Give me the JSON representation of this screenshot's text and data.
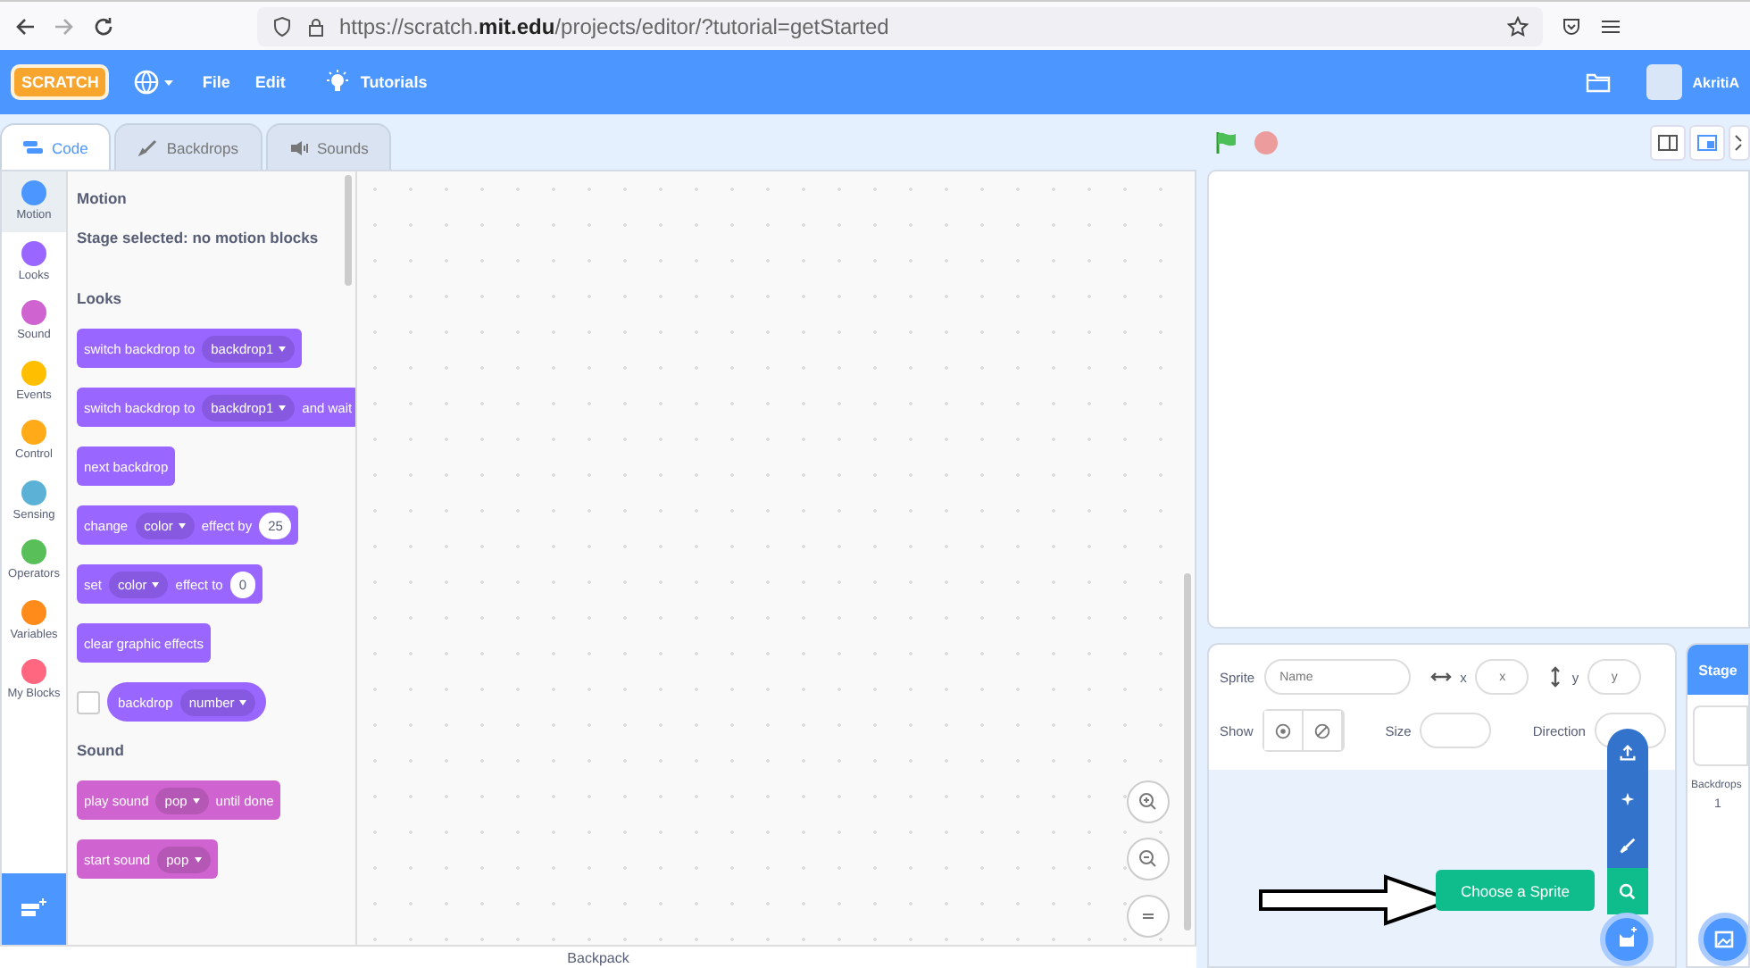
{
  "browser": {
    "url": "https://scratch.**mit.edu**/projects/editor/?tutorial=getStarted"
  },
  "menubar": {
    "logo": "SCRATCH",
    "items": [
      "File",
      "Edit"
    ],
    "tutorials": "Tutorials",
    "user": "AkritiA"
  },
  "tabs": [
    {
      "label": "Code",
      "selected": true
    },
    {
      "label": "Backdrops",
      "selected": false
    },
    {
      "label": "Sounds",
      "selected": false
    }
  ],
  "categories": [
    {
      "label": "Motion",
      "color": "#4c97ff",
      "selected": true
    },
    {
      "label": "Looks",
      "color": "#9966ff",
      "selected": false
    },
    {
      "label": "Sound",
      "color": "#cf63cf",
      "selected": false
    },
    {
      "label": "Events",
      "color": "#ffbf00",
      "selected": false
    },
    {
      "label": "Control",
      "color": "#ffab19",
      "selected": false
    },
    {
      "label": "Sensing",
      "color": "#5cb1d6",
      "selected": false
    },
    {
      "label": "Operators",
      "color": "#59c059",
      "selected": false
    },
    {
      "label": "Variables",
      "color": "#ff8c1a",
      "selected": false
    },
    {
      "label": "My Blocks",
      "color": "#ff6680",
      "selected": false
    }
  ],
  "palette": [
    {
      "title": "Motion",
      "note": "Stage selected: no motion blocks"
    },
    {
      "title": "Looks",
      "color": "#9966ff",
      "blocks": [
        {
          "kind": "stack",
          "parts": [
            {
              "kind": "text",
              "text": "switch backdrop to"
            },
            {
              "kind": "dropdown",
              "text": "backdrop1"
            }
          ]
        },
        {
          "kind": "stack",
          "parts": [
            {
              "kind": "text",
              "text": "switch backdrop to"
            },
            {
              "kind": "dropdown",
              "text": "backdrop1"
            },
            {
              "kind": "text",
              "text": "and wait"
            }
          ]
        },
        {
          "kind": "stack",
          "parts": [
            {
              "kind": "text",
              "text": "next backdrop"
            }
          ]
        },
        {
          "kind": "stack",
          "parts": [
            {
              "kind": "text",
              "text": "change"
            },
            {
              "kind": "dropdown",
              "text": "color"
            },
            {
              "kind": "text",
              "text": "effect by"
            },
            {
              "kind": "number",
              "text": "25"
            }
          ]
        },
        {
          "kind": "stack",
          "parts": [
            {
              "kind": "text",
              "text": "set"
            },
            {
              "kind": "dropdown",
              "text": "color"
            },
            {
              "kind": "text",
              "text": "effect to"
            },
            {
              "kind": "number",
              "text": "0"
            }
          ]
        },
        {
          "kind": "stack",
          "parts": [
            {
              "kind": "text",
              "text": "clear graphic effects"
            }
          ]
        },
        {
          "kind": "reporter",
          "checked": false,
          "parts": [
            {
              "kind": "text",
              "text": "backdrop"
            },
            {
              "kind": "dropdown",
              "text": "number"
            }
          ]
        }
      ]
    },
    {
      "title": "Sound",
      "color": "#cf63cf",
      "blocks": [
        {
          "kind": "stack",
          "parts": [
            {
              "kind": "text",
              "text": "play sound"
            },
            {
              "kind": "dropdown",
              "text": "pop"
            },
            {
              "kind": "text",
              "text": "until done"
            }
          ]
        },
        {
          "kind": "stack",
          "parts": [
            {
              "kind": "text",
              "text": "start sound"
            },
            {
              "kind": "dropdown",
              "text": "pop"
            }
          ]
        }
      ]
    }
  ],
  "sprite_info": {
    "sprite_label": "Sprite",
    "name_placeholder": "Name",
    "x_label": "x",
    "x_placeholder": "x",
    "y_label": "y",
    "y_placeholder": "y",
    "show_label": "Show",
    "size_label": "Size",
    "direction_label": "Direction"
  },
  "tooltip": "Choose a Sprite",
  "stage_selector": {
    "title": "Stage",
    "backdrops_label": "Backdrops",
    "backdrops_count": "1"
  },
  "backpack": "Backpack"
}
